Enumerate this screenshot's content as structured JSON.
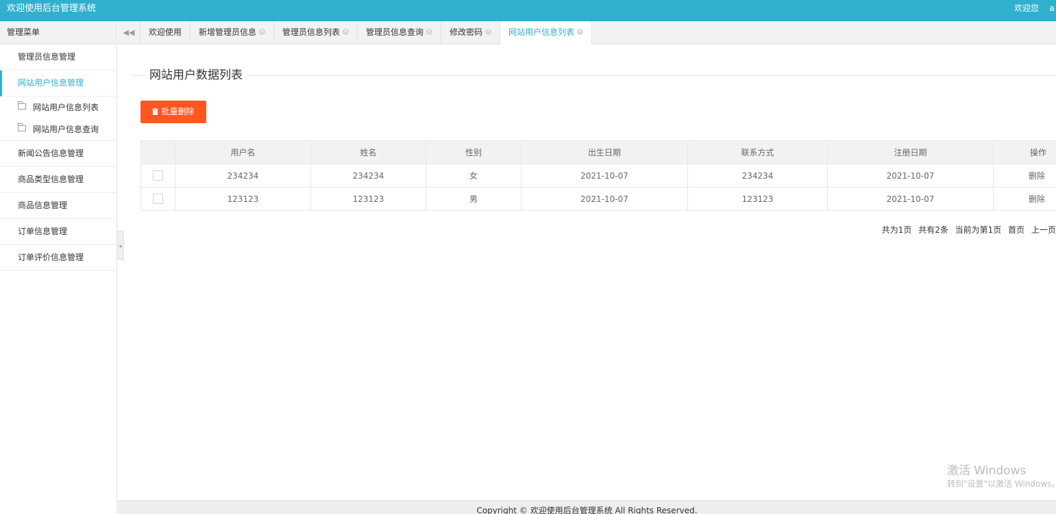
{
  "header": {
    "title": "欢迎使用后台管理系统",
    "welcome": "欢迎您",
    "user": "a"
  },
  "sidebar": {
    "title": "管理菜单",
    "items": [
      {
        "label": "管理员信息管理"
      },
      {
        "label": "网站用户信息管理",
        "children": [
          "网站用户信息列表",
          "网站用户信息查询"
        ]
      },
      {
        "label": "新闻公告信息管理"
      },
      {
        "label": "商品类型信息管理"
      },
      {
        "label": "商品信息管理"
      },
      {
        "label": "订单信息管理"
      },
      {
        "label": "订单评价信息管理"
      }
    ]
  },
  "tabs": [
    "欢迎使用",
    "新增管理员信息",
    "管理员信息列表",
    "管理员信息查询",
    "修改密码",
    "网站用户信息列表"
  ],
  "main": {
    "section_title": "网站用户数据列表",
    "batch_delete_label": "批量删除",
    "table": {
      "columns": [
        "用户名",
        "姓名",
        "性别",
        "出生日期",
        "联系方式",
        "注册日期",
        "操作"
      ],
      "rows": [
        [
          "234234",
          "234234",
          "女",
          "2021-10-07",
          "234234",
          "2021-10-07",
          "删除"
        ],
        [
          "123123",
          "123123",
          "男",
          "2021-10-07",
          "123123",
          "2021-10-07",
          "删除"
        ]
      ]
    },
    "pagination": {
      "total_pages": "共为1页",
      "total_records": "共有2条",
      "current": "当前为第1页",
      "first": "首页",
      "prev": "上一页"
    }
  },
  "footer": {
    "text": "Copyright © 欢迎使用后台管理系统 All Rights Reserved."
  },
  "watermark": {
    "line1": "激活 Windows",
    "line2": "转到\"设置\"以激活 Windows。"
  },
  "colors": {
    "accent": "#31b0ce",
    "danger": "#ff5722"
  },
  "icons": {
    "tab_nav": "double-left-arrow-icon",
    "folder": "folder-icon",
    "trash": "trash-icon",
    "tab_close": "close-circle-icon"
  }
}
